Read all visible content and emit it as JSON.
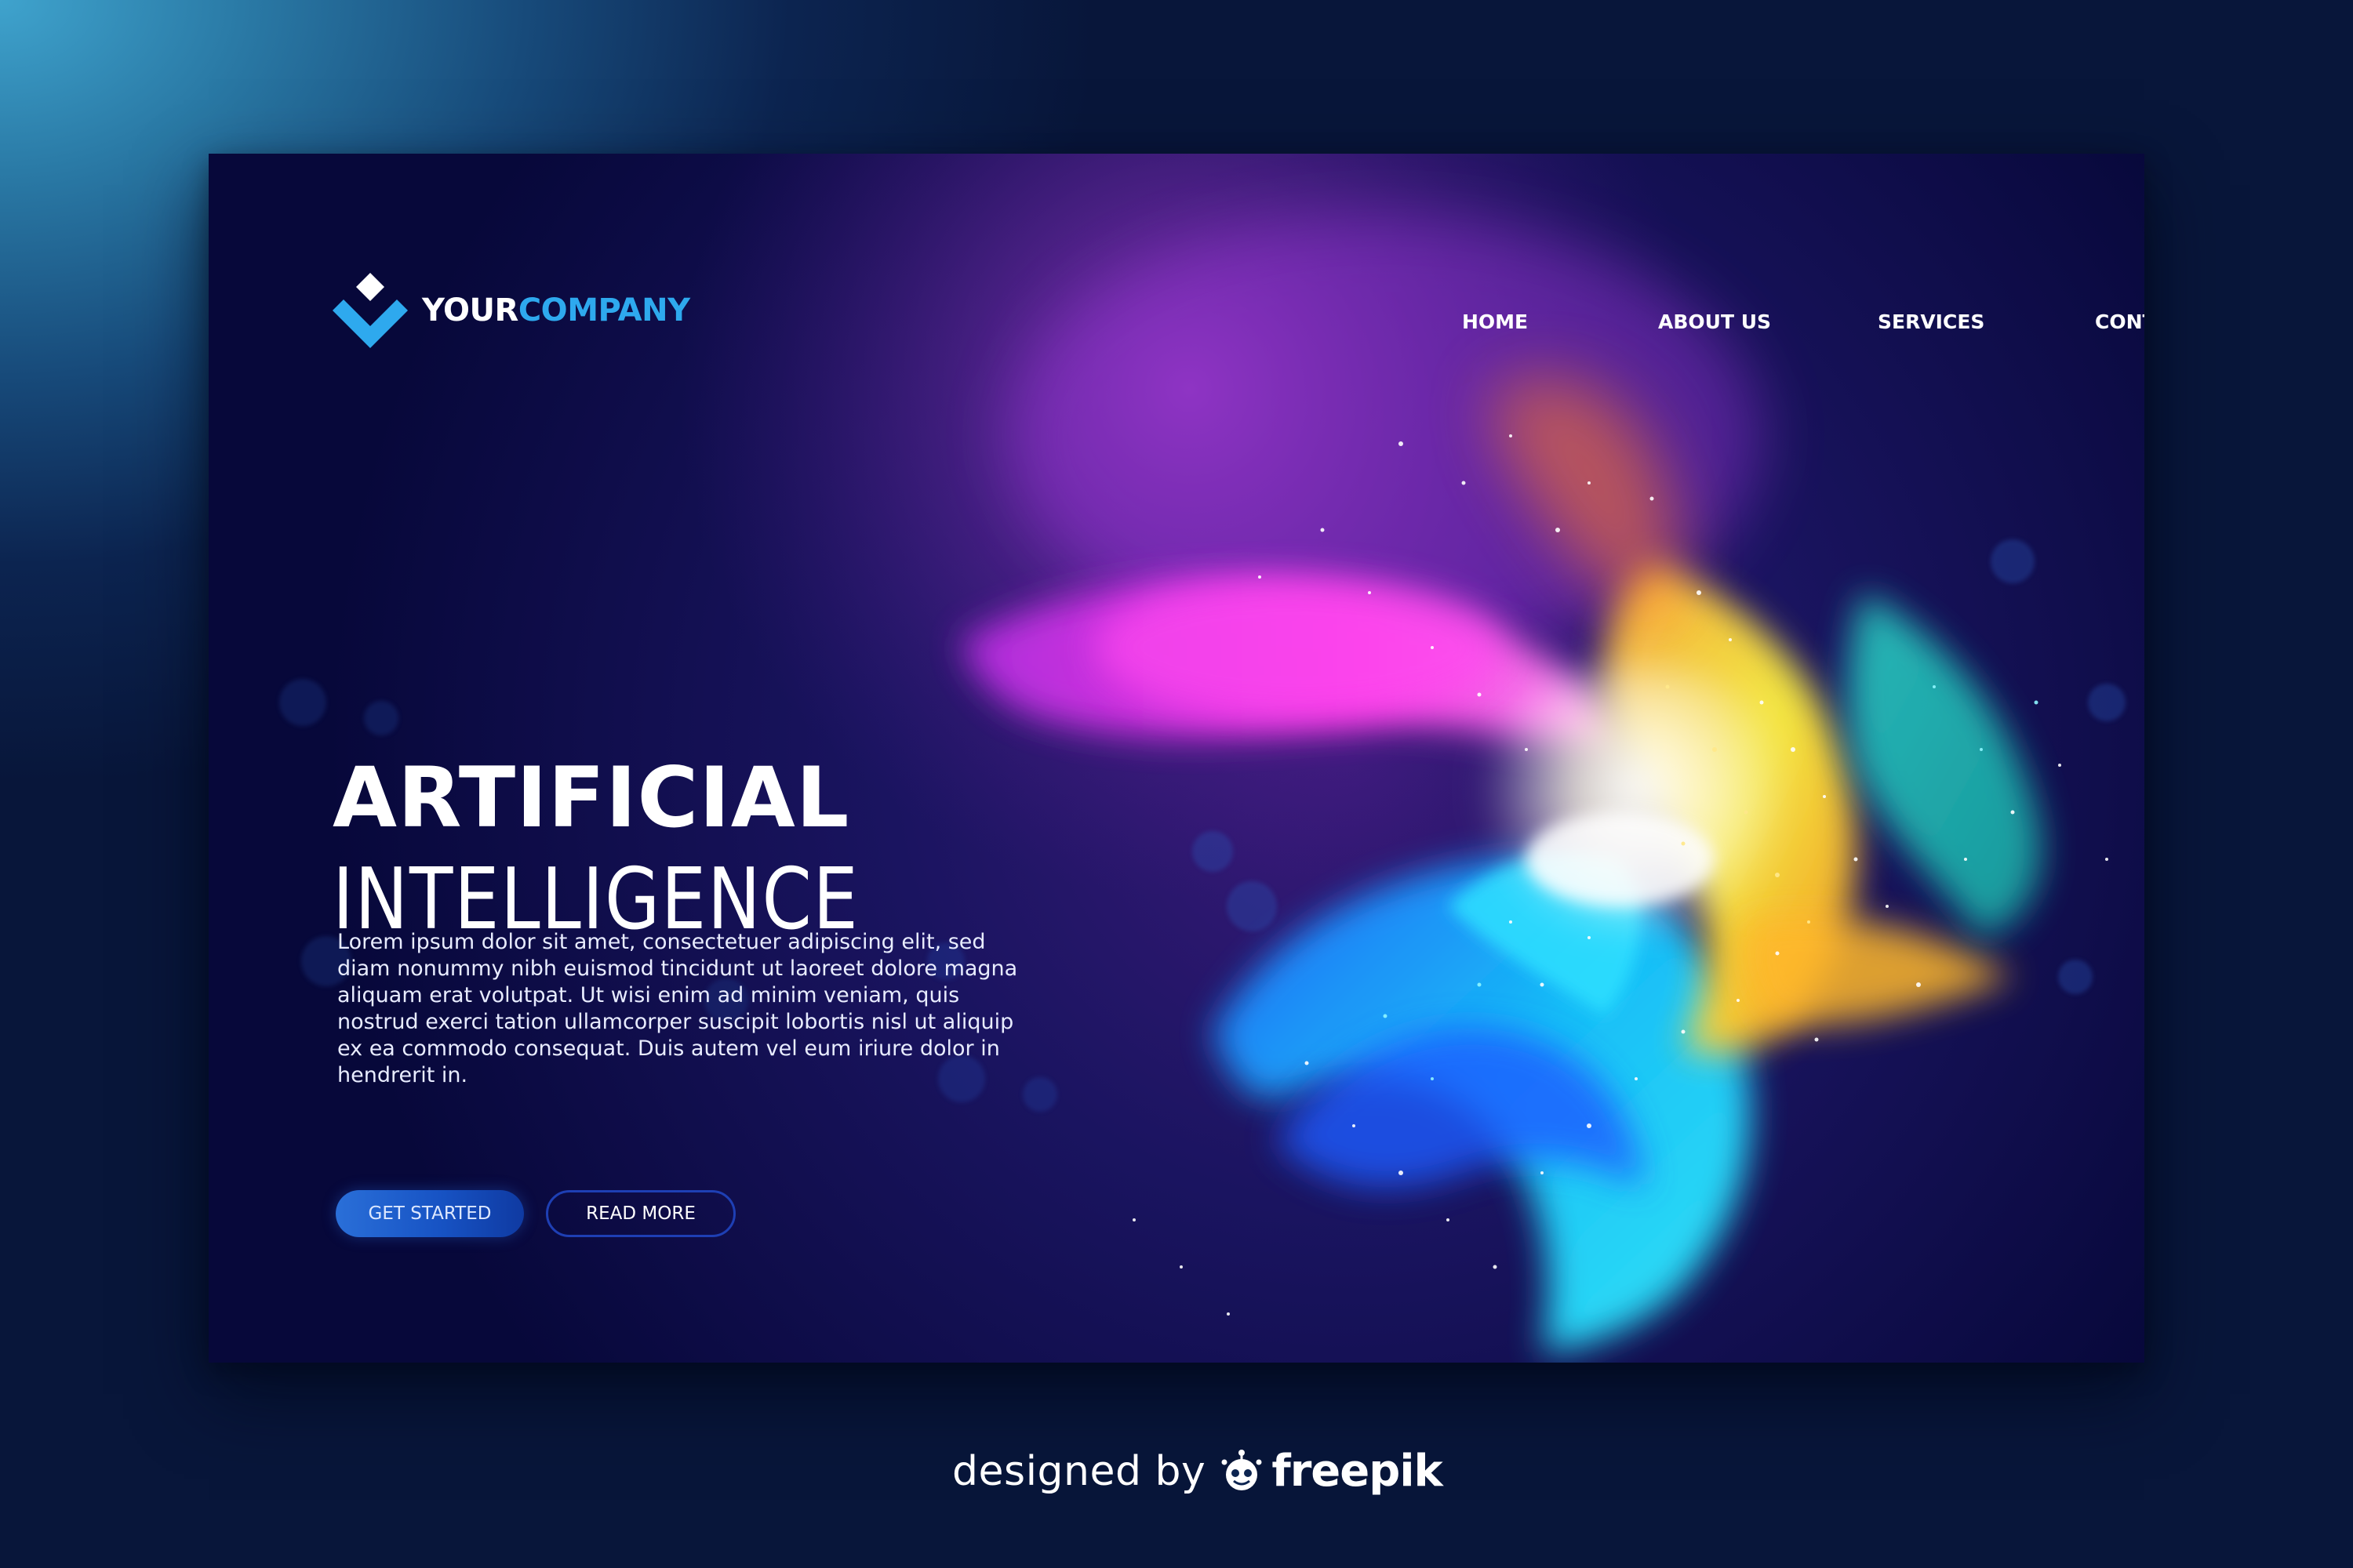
{
  "brand": {
    "logo_icon": "diamond-chevron-logo-icon",
    "name_part1": "YOUR",
    "name_part2": "COMPANY",
    "accent_color": "#2ea9ee"
  },
  "nav": {
    "items": [
      {
        "label": "HOME"
      },
      {
        "label": "ABOUT US"
      },
      {
        "label": "SERVICES"
      },
      {
        "label": "CONTACT US"
      }
    ]
  },
  "hero": {
    "title_line1": "ARTIFICIAL",
    "title_line2": "INTELLIGENCE",
    "body": "Lorem ipsum dolor sit amet, consectetuer adipiscing elit, sed diam nonummy nibh euismod tincidunt ut laoreet dolore magna aliquam erat volutpat. Ut wisi enim ad minim veniam, quis nostrud exerci tation ullamcorper suscipit lobortis nisl ut aliquip ex ea commodo consequat. Duis autem vel eum iriure dolor in hendrerit in.",
    "primary_button": "GET STARTED",
    "secondary_button": "READ MORE"
  },
  "credit": {
    "prefix": "designed by",
    "brand": "freepik",
    "icon": "freepik-logo-icon"
  },
  "colors": {
    "card_background": "#08093a",
    "primary_button": "#1753c4",
    "secondary_button_border": "#1e3fb4"
  }
}
